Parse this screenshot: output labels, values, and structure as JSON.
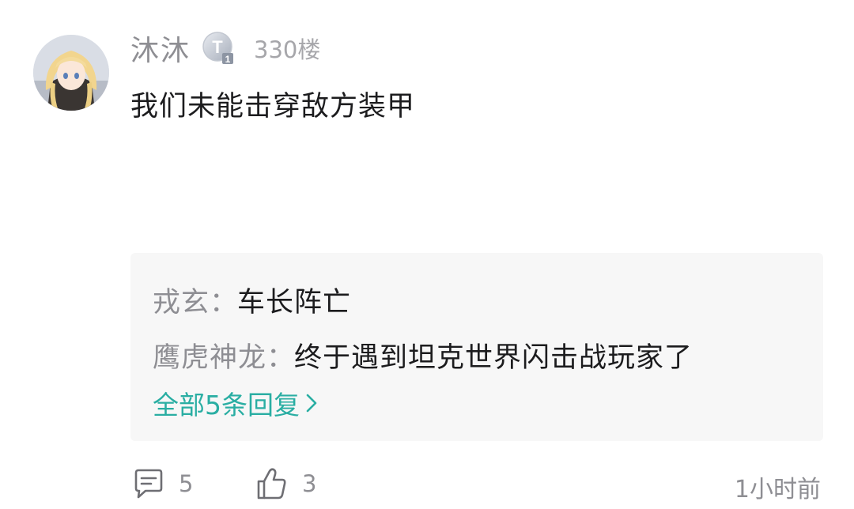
{
  "comment": {
    "username": "沐沐",
    "level_badge_letter": "T",
    "level_badge_number": "1",
    "floor": "330楼",
    "content": "我们未能击穿敌方装甲"
  },
  "replies": {
    "separator": "：",
    "items": [
      {
        "user": "戎玄",
        "text": "车长阵亡"
      },
      {
        "user": "鹰虎神龙",
        "text": "终于遇到坦克世界闪击战玩家了"
      }
    ],
    "view_all_label": "全部5条回复"
  },
  "footer": {
    "comment_icon": "comment-bubble-icon",
    "comment_count": "5",
    "like_icon": "thumbs-up-icon",
    "like_count": "3",
    "timestamp": "1小时前"
  },
  "colors": {
    "accent": "#2aaea3",
    "muted_text": "#8e8e93",
    "primary_text": "#1c1c1e",
    "reply_background": "#f7f7f7"
  }
}
